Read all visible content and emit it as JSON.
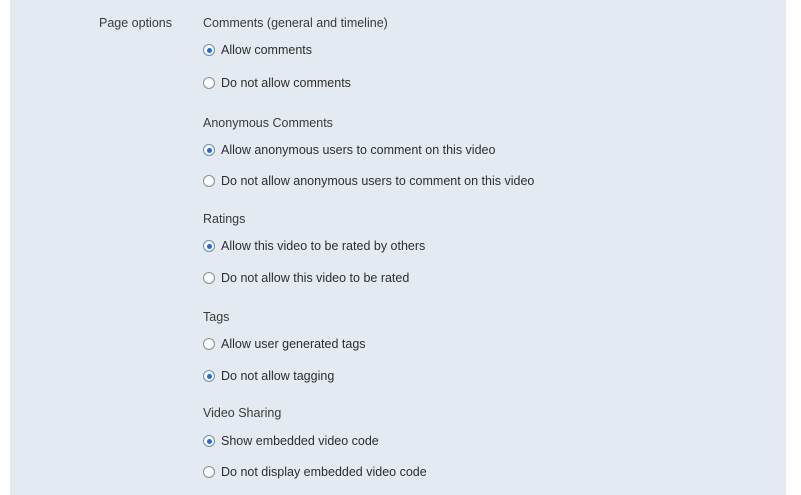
{
  "page_options_label": "Page options",
  "groups": [
    {
      "title": "Comments (general and timeline)",
      "options": [
        {
          "label": "Allow comments",
          "selected": true
        },
        {
          "label": "Do not allow comments",
          "selected": false
        }
      ]
    },
    {
      "title": "Anonymous Comments",
      "options": [
        {
          "label": "Allow anonymous users to comment on this video",
          "selected": true
        },
        {
          "label": "Do not allow anonymous users to comment on this video",
          "selected": false
        }
      ]
    },
    {
      "title": "Ratings",
      "options": [
        {
          "label": "Allow this video to be rated by others",
          "selected": true
        },
        {
          "label": "Do not allow this video to be rated",
          "selected": false
        }
      ]
    },
    {
      "title": "Tags",
      "options": [
        {
          "label": "Allow user generated tags",
          "selected": false
        },
        {
          "label": "Do not allow tagging",
          "selected": true
        }
      ]
    },
    {
      "title": "Video Sharing",
      "options": [
        {
          "label": "Show embedded video code",
          "selected": true
        },
        {
          "label": "Do not display embedded video code",
          "selected": false
        }
      ]
    }
  ]
}
